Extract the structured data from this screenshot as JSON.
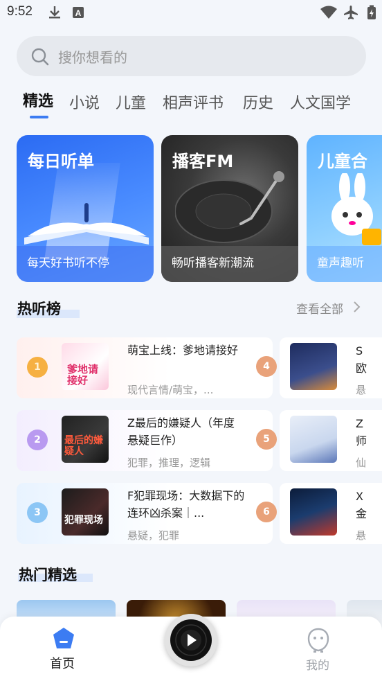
{
  "status_bar": {
    "time": "9:52"
  },
  "search": {
    "placeholder": "搜你想看的"
  },
  "tabs": [
    "精选",
    "小说",
    "儿童",
    "相声评书",
    "历史",
    "人文国学"
  ],
  "banners": [
    {
      "title": "每日听单",
      "subtitle": "每天好书听不停"
    },
    {
      "title": "播客FM",
      "subtitle": "畅听播客新潮流"
    },
    {
      "title": "儿童合",
      "subtitle": "童声趣听"
    }
  ],
  "hot_list": {
    "title": "热听榜",
    "see_all": "查看全部",
    "items": [
      {
        "rank": "1",
        "title": "萌宝上线：爹地请接好",
        "sub": "现代言情/萌宝，...",
        "cover_text": "爹地请接好"
      },
      {
        "rank": "2",
        "title": "Z最后的嫌疑人（年度悬疑巨作）",
        "sub": "犯罪，推理，逻辑",
        "cover_text": "最后的嫌疑人"
      },
      {
        "rank": "3",
        "title": "F犯罪现场：大数据下的连环凶杀案｜...",
        "sub": "悬疑，犯罪",
        "cover_text": "犯罪现场"
      },
      {
        "rank": "4",
        "title": "S",
        "line2": "欧",
        "sub": "悬"
      },
      {
        "rank": "5",
        "title": "Z",
        "line2": "师",
        "sub": "仙"
      },
      {
        "rank": "6",
        "title": "X",
        "line2": "金",
        "sub": "悬"
      }
    ]
  },
  "hot_picks": {
    "title": "热门精选"
  },
  "bottom_nav": {
    "home": "首页",
    "mine": "我的"
  }
}
